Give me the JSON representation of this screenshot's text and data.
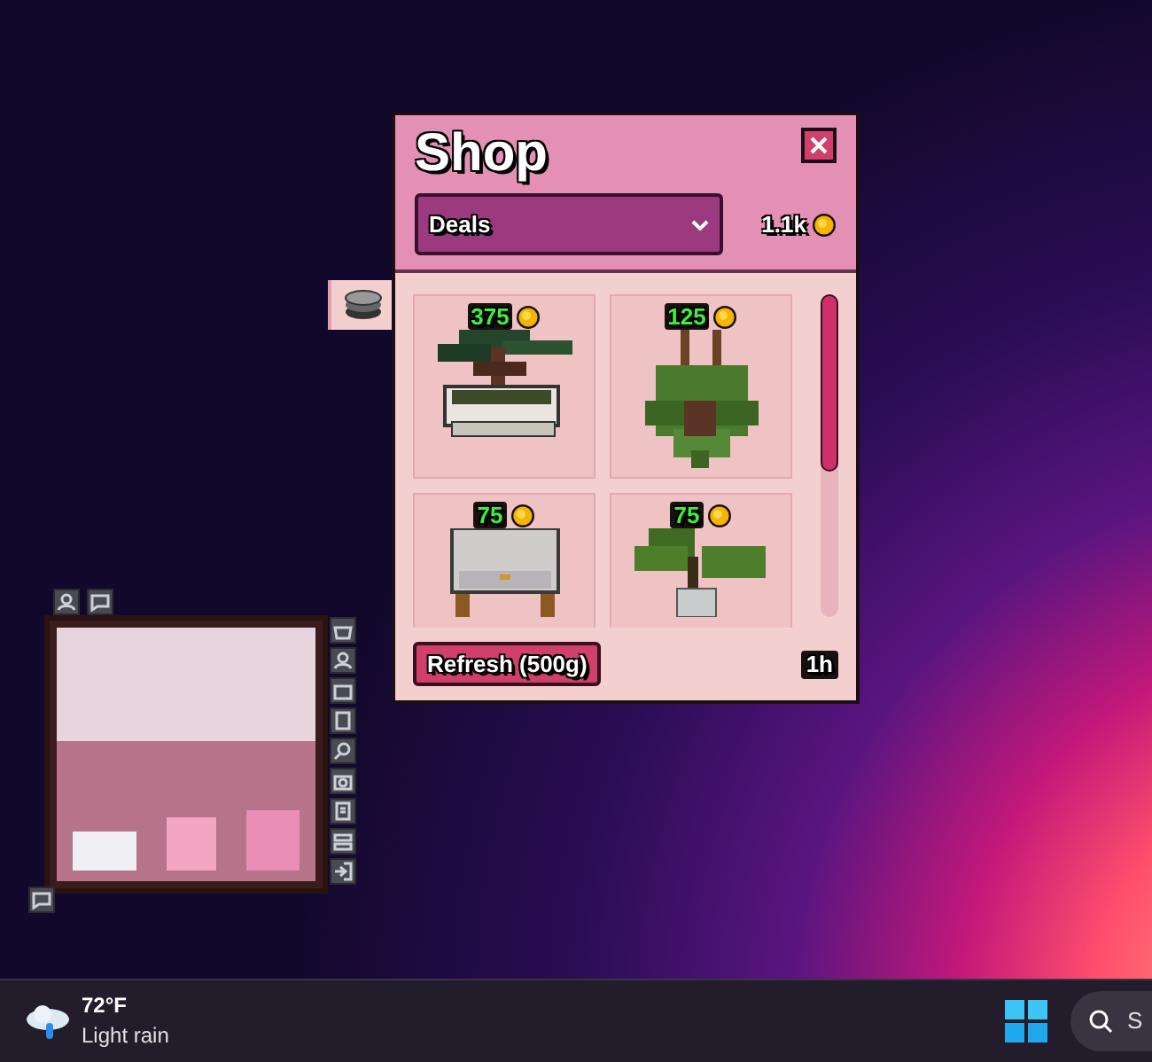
{
  "shop": {
    "title": "Shop",
    "category": "Deals",
    "balance": "1.1k",
    "items": [
      {
        "price": "375",
        "kind": "bonsai"
      },
      {
        "price": "125",
        "kind": "hanging-plant"
      },
      {
        "price": "75",
        "kind": "nightstand"
      },
      {
        "price": "75",
        "kind": "potted-plant"
      }
    ],
    "refresh_button": "Refresh (500g)",
    "timer": "1h"
  },
  "taskbar": {
    "weather": {
      "temperature": "72°F",
      "condition": "Light rain"
    },
    "search": {
      "placeholder": "S"
    }
  }
}
